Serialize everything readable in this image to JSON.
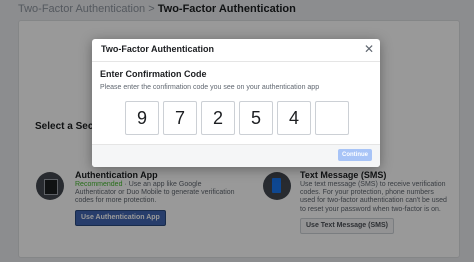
{
  "breadcrumb": {
    "parent": "Two-Factor Authentication",
    "separator": ">",
    "current": "Two-Factor Authentication"
  },
  "section": {
    "title": "Select a Security Method"
  },
  "methods": [
    {
      "name": "Authentication App",
      "recommended": "Recommended",
      "description": " · Use an app like Google Authenticator or Duo Mobile to generate verification codes for more protection.",
      "button": "Use Authentication App",
      "icon": "qr-phone-icon"
    },
    {
      "name": "Text Message (SMS)",
      "description": "Use text message (SMS) to receive verification codes. For your protection, phone numbers used for two-factor authentication can't be used to reset your password when two-factor is on.",
      "button": "Use Text Message (SMS)",
      "icon": "phone-icon"
    }
  ],
  "modal": {
    "title": "Two-Factor Authentication",
    "close_icon": "close-icon",
    "code_title": "Enter Confirmation Code",
    "code_desc": "Please enter the confirmation code you see on your authentication app",
    "digits": [
      "9",
      "7",
      "2",
      "5",
      "4",
      ""
    ],
    "continue_label": "Continue"
  }
}
